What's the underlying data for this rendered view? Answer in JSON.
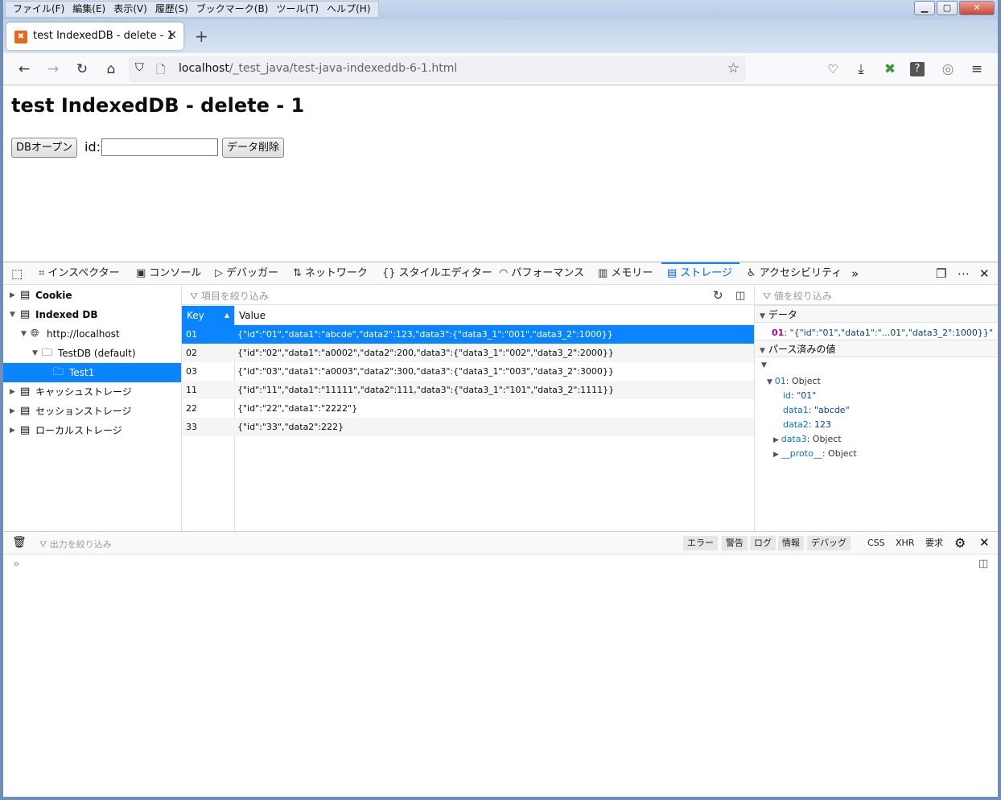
{
  "menubar": {
    "items": [
      "ファイル(F)",
      "編集(E)",
      "表示(V)",
      "履歴(S)",
      "ブックマーク(B)",
      "ツール(T)",
      "ヘルプ(H)"
    ]
  },
  "tab": {
    "title": "test IndexedDB - delete - 1"
  },
  "nav": {
    "url_host": "localhost",
    "url_path": "/_test_java/test-java-indexeddb-6-1.html"
  },
  "page": {
    "heading": "test IndexedDB - delete - 1",
    "open_button": "DBオープン",
    "id_label": "id:",
    "id_value": "",
    "delete_button": "データ削除"
  },
  "devtools": {
    "tabs": [
      "インスペクター",
      "コンソール",
      "デバッガー",
      "ネットワーク",
      "スタイルエディター",
      "パフォーマンス",
      "メモリー",
      "ストレージ",
      "アクセシビリティ"
    ],
    "active_tab": "ストレージ",
    "sidebar": {
      "cookie": "Cookie",
      "indexeddb": "Indexed DB",
      "origin": "http://localhost",
      "database": "TestDB (default)",
      "store": "Test1",
      "cache": "キャッシュストレージ",
      "session": "セッションストレージ",
      "local": "ローカルストレージ"
    },
    "filter_placeholder": "項目を絞り込み",
    "columns": {
      "key": "Key",
      "value": "Value"
    },
    "rows": [
      {
        "key": "01",
        "value": "{\"id\":\"01\",\"data1\":\"abcde\",\"data2\":123,\"data3\":{\"data3_1\":\"001\",\"data3_2\":1000}}"
      },
      {
        "key": "02",
        "value": "{\"id\":\"02\",\"data1\":\"a0002\",\"data2\":200,\"data3\":{\"data3_1\":\"002\",\"data3_2\":2000}}"
      },
      {
        "key": "03",
        "value": "{\"id\":\"03\",\"data1\":\"a0003\",\"data2\":300,\"data3\":{\"data3_1\":\"003\",\"data3_2\":3000}}"
      },
      {
        "key": "11",
        "value": "{\"id\":\"11\",\"data1\":\"11111\",\"data2\":111,\"data3\":{\"data3_1\":\"101\",\"data3_2\":1111}}"
      },
      {
        "key": "22",
        "value": "{\"id\":\"22\",\"data1\":\"2222\"}"
      },
      {
        "key": "33",
        "value": "{\"id\":\"33\",\"data2\":222}"
      }
    ],
    "right": {
      "filter_placeholder": "値を絞り込み",
      "data_section": "データ",
      "data_key": "01",
      "data_value": "\"{\"id\":\"01\",\"data1\":\"...01\",\"data3_2\":1000}}\"",
      "parsed_section": "パース済みの値",
      "obj_key": "01",
      "obj_type": "Object",
      "id_key": "id",
      "id_val": "\"01\"",
      "data1_key": "data1",
      "data1_val": "\"abcde\"",
      "data2_key": "data2",
      "data2_val": "123",
      "data3_key": "data3",
      "data3_val": "Object",
      "proto_key": "__proto__",
      "proto_val": "Object"
    },
    "console": {
      "filter_placeholder": "出力を絞り込み",
      "levels": [
        "エラー",
        "警告",
        "ログ",
        "情報",
        "デバッグ"
      ],
      "extras": [
        "CSS",
        "XHR",
        "要求"
      ]
    }
  }
}
